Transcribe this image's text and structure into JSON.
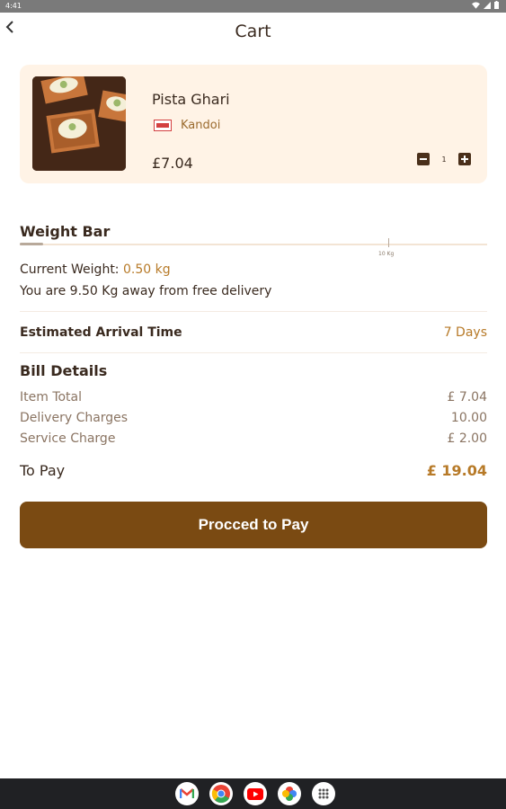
{
  "status_bar": {
    "time": "4:41"
  },
  "header": {
    "title": "Cart"
  },
  "cart_item": {
    "name": "Pista Ghari",
    "brand": "Kandoi",
    "price": "£7.04",
    "quantity": "1"
  },
  "weight_bar": {
    "title": "Weight Bar",
    "tick_label": "10 Kg",
    "progress_fraction": 0.05,
    "current_weight_label": "Current Weight:",
    "current_weight_value": "0.50 kg",
    "away_text": "You are 9.50 Kg away from free delivery"
  },
  "eta": {
    "label": "Estimated Arrival Time",
    "value": "7 Days"
  },
  "bill": {
    "title": "Bill Details",
    "rows": [
      {
        "label": "Item Total",
        "amount": "£ 7.04"
      },
      {
        "label": "Delivery Charges",
        "amount": "10.00"
      },
      {
        "label": "Service Charge",
        "amount": "£ 2.00"
      }
    ],
    "to_pay_label": "To Pay",
    "to_pay_amount": "£ 19.04"
  },
  "actions": {
    "proceed_label": "Procced to Pay"
  },
  "dock": {
    "apps": [
      "gmail-icon",
      "chrome-icon",
      "youtube-icon",
      "photos-icon",
      "app-drawer-icon"
    ]
  },
  "colors": {
    "accent": "#b77a28",
    "button": "#7a4a12",
    "card_bg": "#fff3e6",
    "text": "#3a2a1f"
  }
}
